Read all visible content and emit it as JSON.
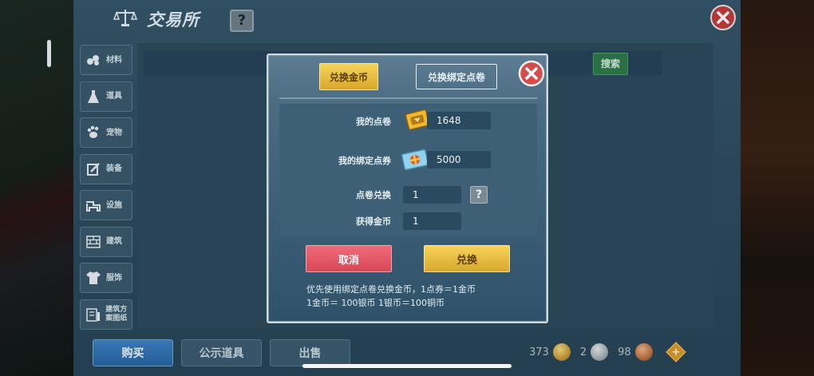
{
  "header": {
    "title": "交易所",
    "help_label": "?"
  },
  "sidebar": {
    "items": [
      {
        "label": "材料",
        "icon": "material-icon"
      },
      {
        "label": "道具",
        "icon": "flask-icon"
      },
      {
        "label": "宠物",
        "icon": "paw-icon"
      },
      {
        "label": "装备",
        "icon": "armor-icon"
      },
      {
        "label": "设施",
        "icon": "facility-icon"
      },
      {
        "label": "建筑",
        "icon": "brick-icon"
      },
      {
        "label": "服饰",
        "icon": "clothing-icon"
      },
      {
        "label": "建筑方案图纸",
        "icon": "blueprint-icon"
      }
    ]
  },
  "search": {
    "button_label": "搜索"
  },
  "bottom_tabs": [
    {
      "label": "购买",
      "active": true
    },
    {
      "label": "公示道具",
      "active": false
    },
    {
      "label": "出售",
      "active": false
    }
  ],
  "currency": {
    "gold": "373",
    "silver": "2",
    "copper": "98",
    "add_label": "+"
  },
  "dialog": {
    "tabs": {
      "exchange_gold": "兑换金币",
      "exchange_bound": "兑换绑定点卷"
    },
    "my_points_label": "我的点卷",
    "my_points_value": "1648",
    "my_bound_label": "我的绑定点券",
    "my_bound_value": "5000",
    "exchange_label": "点卷兑换",
    "exchange_value": "1",
    "help_label": "?",
    "gain_label": "获得金币",
    "gain_value": "1",
    "cancel_label": "取消",
    "confirm_label": "兑换",
    "note_line1": "优先使用绑定点卷兑换金币，1点券＝1金币",
    "note_line2": "1金币＝ 100银币  1银币＝100铜币"
  },
  "colors": {
    "accent_gold": "#d8a82a",
    "cancel_red": "#d84757",
    "close_red": "#d94b4b",
    "active_tab_blue": "#2a66a3"
  }
}
